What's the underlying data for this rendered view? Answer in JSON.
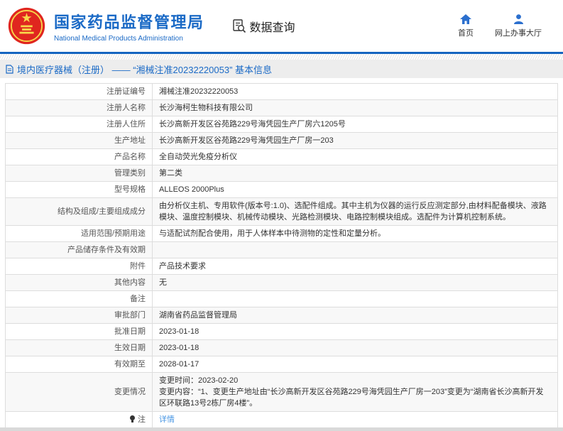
{
  "header": {
    "org_name_cn": "国家药品监督管理局",
    "org_name_en": "National Medical Products Administration",
    "section_label": "数据查询",
    "nav": [
      {
        "label": "首页",
        "icon": "home-icon"
      },
      {
        "label": "网上办事大厅",
        "icon": "user-icon"
      }
    ]
  },
  "page_title": "境内医疗器械（注册） —— “湘械注准20232220053” 基本信息",
  "colors": {
    "brand_blue": "#1b6ac6",
    "divider_blue": "#1565c0",
    "link_blue": "#4896e3",
    "stripe_gray": "#f8f8f8",
    "emblem_red": "#e0261f",
    "emblem_gold": "#f7d64a"
  },
  "table": {
    "rows": [
      {
        "label": "注册证编号",
        "value": "湘械注准20232220053"
      },
      {
        "label": "注册人名称",
        "value": "长沙海柯生物科技有限公司"
      },
      {
        "label": "注册人住所",
        "value": "长沙高新开发区谷苑路229号海凭园生产厂房六1205号"
      },
      {
        "label": "生产地址",
        "value": "长沙高新开发区谷苑路229号海凭园生产厂房一203"
      },
      {
        "label": "产品名称",
        "value": "全自动荧光免疫分析仪"
      },
      {
        "label": "管理类别",
        "value": "第二类"
      },
      {
        "label": "型号规格",
        "value": "ALLEOS 2000Plus"
      },
      {
        "label": "结构及组成/主要组成成分",
        "value": "由分析仪主机、专用软件(版本号:1.0)、选配件组成。其中主机为仪器的运行反应测定部分,由材料配备模块、液路模块、温度控制模块、机械传动模块、光路检测模块、电路控制模块组成。选配件为计算机控制系统。"
      },
      {
        "label": "适用范围/预期用途",
        "value": "与适配试剂配合使用，用于人体样本中待测物的定性和定量分析。"
      },
      {
        "label": "产品储存条件及有效期",
        "value": ""
      },
      {
        "label": "附件",
        "value": "产品技术要求"
      },
      {
        "label": "其他内容",
        "value": "无"
      },
      {
        "label": "备注",
        "value": ""
      },
      {
        "label": "审批部门",
        "value": "湖南省药品监督管理局"
      },
      {
        "label": "批准日期",
        "value": "2023-01-18"
      },
      {
        "label": "生效日期",
        "value": "2023-01-18"
      },
      {
        "label": "有效期至",
        "value": "2028-01-17"
      },
      {
        "label": "变更情况",
        "value": "变更时间：2023-02-20\n变更内容：“1、变更生产地址由“长沙高新开发区谷苑路229号海凭园生产厂房一203”变更为“湖南省长沙高新开发区环联路13号2栋厂房4楼”。"
      },
      {
        "label": "注",
        "label_icon": "bulb-icon",
        "value": "详情",
        "value_is_link": true
      }
    ]
  }
}
